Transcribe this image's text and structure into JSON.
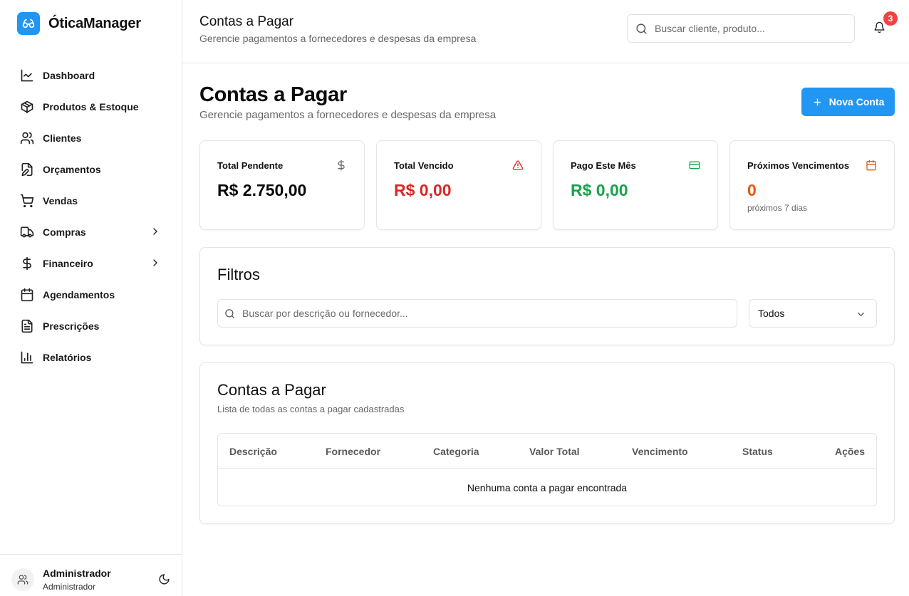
{
  "app": {
    "name": "ÓticaManager",
    "accent_color": "#2196f3"
  },
  "sidebar": {
    "items": [
      {
        "label": "Dashboard",
        "icon": "chart-line-icon"
      },
      {
        "label": "Produtos & Estoque",
        "icon": "package-icon"
      },
      {
        "label": "Clientes",
        "icon": "users-icon"
      },
      {
        "label": "Orçamentos",
        "icon": "file-edit-icon"
      },
      {
        "label": "Vendas",
        "icon": "shopping-cart-icon"
      },
      {
        "label": "Compras",
        "icon": "truck-icon",
        "expandable": true
      },
      {
        "label": "Financeiro",
        "icon": "dollar-icon",
        "expandable": true
      },
      {
        "label": "Agendamentos",
        "icon": "calendar-icon"
      },
      {
        "label": "Prescrições",
        "icon": "file-text-icon"
      },
      {
        "label": "Relatórios",
        "icon": "bar-chart-icon"
      }
    ],
    "user": {
      "name": "Administrador",
      "role": "Administrador"
    }
  },
  "header": {
    "title": "Contas a Pagar",
    "subtitle": "Gerencie pagamentos a fornecedores e despesas da empresa",
    "search_placeholder": "Buscar cliente, produto...",
    "notification_count": "3"
  },
  "page": {
    "title": "Contas a Pagar",
    "subtitle": "Gerencie pagamentos a fornecedores e despesas da empresa",
    "new_button_label": "Nova Conta"
  },
  "stats": {
    "pending": {
      "label": "Total Pendente",
      "value": "R$ 2.750,00",
      "color": "#0a0a0a",
      "icon": "dollar-icon"
    },
    "overdue": {
      "label": "Total Vencido",
      "value": "R$ 0,00",
      "color": "#dc2626",
      "icon": "alert-triangle-icon"
    },
    "paid": {
      "label": "Pago Este Mês",
      "value": "R$ 0,00",
      "color": "#16a34a",
      "icon": "credit-card-icon"
    },
    "upcoming": {
      "label": "Próximos Vencimentos",
      "value": "0",
      "sub": "próximos 7 dias",
      "color": "#ea580c",
      "icon": "calendar-icon"
    }
  },
  "filters": {
    "title": "Filtros",
    "search_placeholder": "Buscar por descrição ou fornecedor...",
    "status_selected": "Todos"
  },
  "table": {
    "title": "Contas a Pagar",
    "subtitle": "Lista de todas as contas a pagar cadastradas",
    "columns": [
      "Descrição",
      "Fornecedor",
      "Categoria",
      "Valor Total",
      "Vencimento",
      "Status",
      "Ações"
    ],
    "empty_message": "Nenhuma conta a pagar encontrada"
  }
}
